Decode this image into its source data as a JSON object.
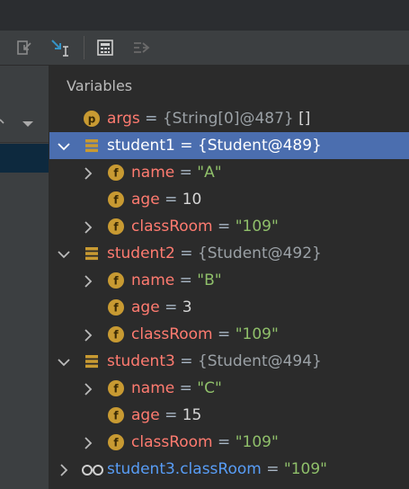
{
  "panel": {
    "title": "Variables"
  },
  "rows": [
    {
      "name": "args",
      "eq": " = ",
      "value": "{String[0]@487}",
      "suffix": " []",
      "kind": "param"
    },
    {
      "name": "student1",
      "eq": " = ",
      "value": "{Student@489}",
      "kind": "object",
      "selected": true
    },
    {
      "name": "name",
      "eq": " = ",
      "value": "\"A\"",
      "kind": "field"
    },
    {
      "name": "age",
      "eq": " = ",
      "value": "10",
      "kind": "field"
    },
    {
      "name": "classRoom",
      "eq": " = ",
      "value": "\"109\"",
      "kind": "field"
    },
    {
      "name": "student2",
      "eq": " = ",
      "value": "{Student@492}",
      "kind": "object"
    },
    {
      "name": "name",
      "eq": " = ",
      "value": "\"B\"",
      "kind": "field"
    },
    {
      "name": "age",
      "eq": " = ",
      "value": "3",
      "kind": "field"
    },
    {
      "name": "classRoom",
      "eq": " = ",
      "value": "\"109\"",
      "kind": "field"
    },
    {
      "name": "student3",
      "eq": " = ",
      "value": "{Student@494}",
      "kind": "object"
    },
    {
      "name": "name",
      "eq": " = ",
      "value": "\"C\"",
      "kind": "field"
    },
    {
      "name": "age",
      "eq": " = ",
      "value": "15",
      "kind": "field"
    },
    {
      "name": "classRoom",
      "eq": " = ",
      "value": "\"109\"",
      "kind": "field"
    },
    {
      "name": "student3.classRoom",
      "eq": " = ",
      "value": "\"109\"",
      "kind": "watch"
    }
  ],
  "icons": {
    "toolbar": [
      "step-out-icon",
      "run-to-cursor-icon",
      "evaluate-expression-icon",
      "trace-stream-icon"
    ],
    "param": "p-badge-icon",
    "field": "f-badge-icon",
    "object": "object-stack-icon",
    "watch": "glasses-watch-icon"
  },
  "colors": {
    "selection": "#4b6eaf",
    "variable_name": "#ff7b70",
    "watch_name": "#589df6",
    "string_value": "#8fbf6a",
    "badge": "#c89a32"
  }
}
